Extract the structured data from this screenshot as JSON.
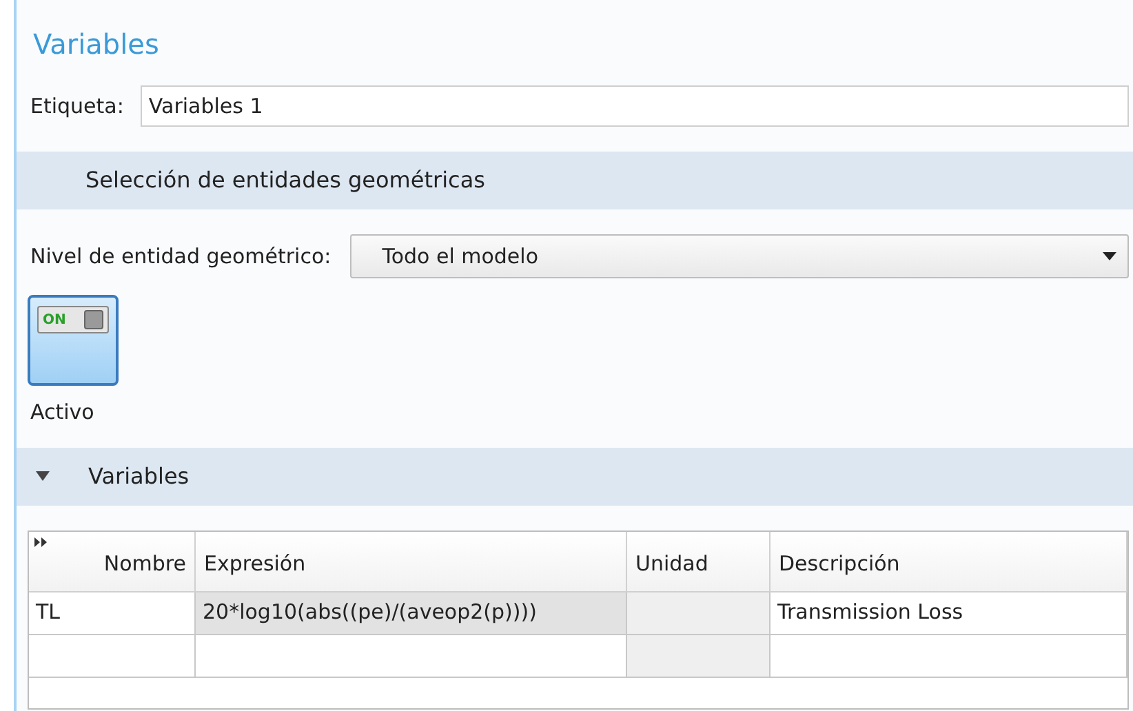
{
  "title": "Variables",
  "label_field": {
    "label": "Etiqueta:",
    "value": "Variables 1"
  },
  "selection_section": {
    "heading": "Selección de entidades geométricas",
    "level_label": "Nivel de entidad geométrico:",
    "level_value": "Todo el modelo"
  },
  "active_toggle": {
    "badge": "ON",
    "caption": "Activo",
    "on": true
  },
  "variables_section": {
    "heading": "Variables",
    "expanded": true,
    "table": {
      "columns": [
        "Nombre",
        "Expresión",
        "Unidad",
        "Descripción"
      ],
      "rows": [
        [
          "TL",
          "20*log10(abs((pe)/(aveop2(p))))",
          "",
          "Transmission Loss"
        ],
        [
          "",
          "",
          "",
          ""
        ]
      ]
    }
  }
}
